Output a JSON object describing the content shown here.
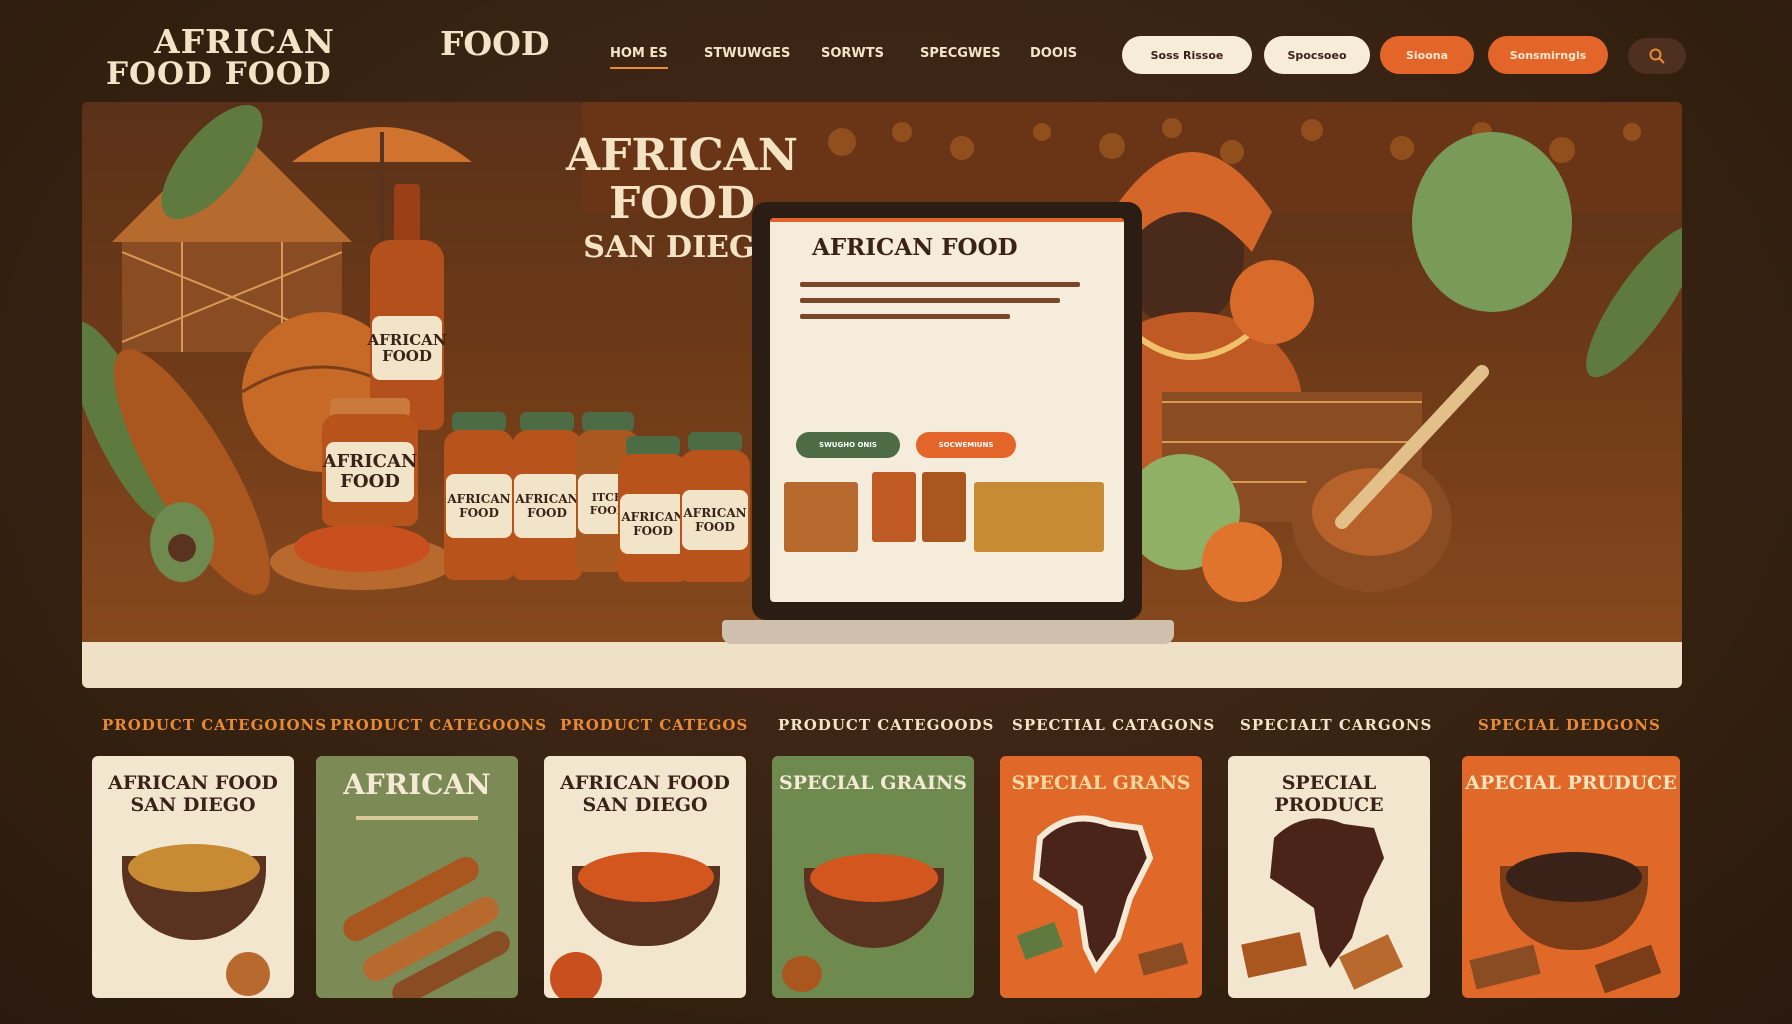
{
  "header": {
    "logo_line1": "AFRICAN",
    "logo_line2": "FOOD FOOD",
    "logo_word": "FOOD",
    "nav": [
      {
        "label": "HOM ES",
        "active": true
      },
      {
        "label": "STWUWGES",
        "active": false
      },
      {
        "label": "SORWTS",
        "active": false
      },
      {
        "label": "SPECGWES",
        "active": false
      },
      {
        "label": "DOOIS",
        "active": false
      }
    ],
    "buttons": [
      {
        "label": "Soss Rissoe",
        "style": "light"
      },
      {
        "label": "Spocsoeo",
        "style": "light"
      },
      {
        "label": "Sioona",
        "style": "orange"
      },
      {
        "label": "Sonsmirngls",
        "style": "orange"
      }
    ],
    "search_icon": "search-icon"
  },
  "hero": {
    "title_line1": "AFRICAN",
    "title_line2": "FOOD",
    "title_line3": "SAN DIEGO",
    "laptop": {
      "title": "AFRICAN FOOD",
      "btn_primary": "SWUGHO ONIS",
      "btn_secondary": "SOCWEMIUNS"
    },
    "bottle_label": "AFRICAN FOOD",
    "jar_labels": [
      "AFRICAN FOOD",
      "AFRICAN FOOD",
      "AFRICAN FOOD",
      "ITCH FOOD",
      "AFRICAN FOOD",
      "AFRICAN FOOD"
    ]
  },
  "category_labels": [
    "PRODUCT CATEGOIONS",
    "PRODUCT CATEGOONS",
    "PRODUCT CATEGOS",
    "PRODUCT CATEGOODS",
    "SPECTIAL CATAGONS",
    "SPECIALT CARGONS",
    "SPECIAL DEDGONS"
  ],
  "cards": [
    {
      "title": "AFRICAN FOOD SAN DIEGO",
      "bg": "#f2e6cf",
      "color": "#3a2218"
    },
    {
      "title": "AFRICAN",
      "bg": "#7c8a55",
      "color": "#f6ead6"
    },
    {
      "title": "AFRICAN FOOD SAN DIEGO",
      "bg": "#f2e6cf",
      "color": "#3a2218"
    },
    {
      "title": "SPECIAL GRAINS",
      "bg": "#6f8a4f",
      "color": "#f6ead6"
    },
    {
      "title": "SPECIAL GRANS",
      "bg": "#e0692a",
      "color": "#f9d79e"
    },
    {
      "title": "SPECIAL PRODUCE",
      "bg": "#f2e6cf",
      "color": "#3a2218"
    },
    {
      "title": "APECIAL PRUDUCE",
      "bg": "#e0692a",
      "color": "#f9e3bd"
    }
  ],
  "colors": {
    "background": "#3a2218",
    "accent_orange": "#e4652a",
    "accent_green": "#4d6b44",
    "cream": "#f3e4c8"
  }
}
